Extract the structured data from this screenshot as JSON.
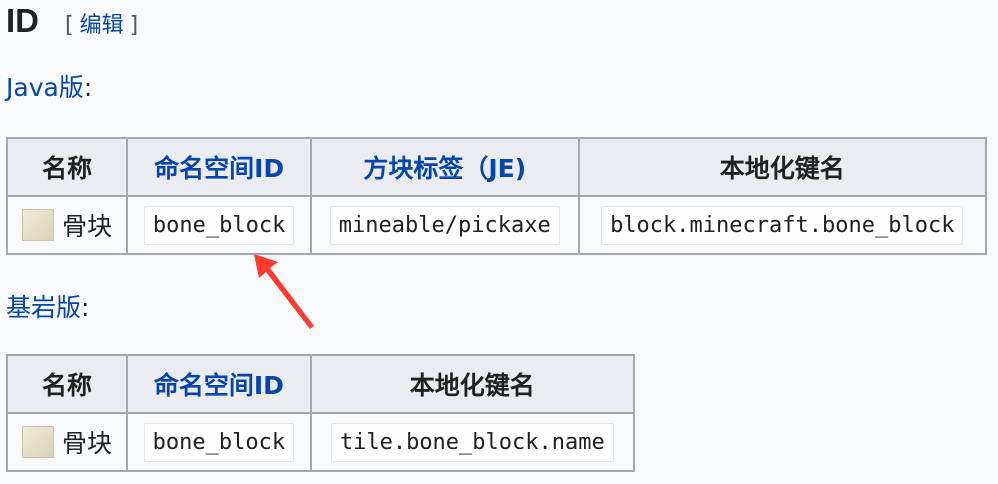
{
  "heading": {
    "title": "ID",
    "edit_open": "[",
    "edit_label": "编辑",
    "edit_close": "]"
  },
  "java": {
    "label": "Java版",
    "colon": ":",
    "headers": [
      "名称",
      "命名空间ID",
      "方块标签（JE)",
      "本地化键名"
    ],
    "row": {
      "icon": "bone-block-icon",
      "name": "骨块",
      "namespaced_id": "bone_block",
      "block_tag": "mineable/pickaxe",
      "translation_key": "block.minecraft.bone_block"
    }
  },
  "bedrock": {
    "label": "基岩版",
    "colon": ":",
    "headers": [
      "名称",
      "命名空间ID",
      "本地化键名"
    ],
    "row": {
      "icon": "bone-block-icon",
      "name": "骨块",
      "namespaced_id": "bone_block",
      "translation_key": "tile.bone_block.name"
    }
  },
  "colors": {
    "link": "#0645ad",
    "border": "#a2a9b1",
    "header_bg": "#eaecf0",
    "arrow": "#ff3b30"
  }
}
